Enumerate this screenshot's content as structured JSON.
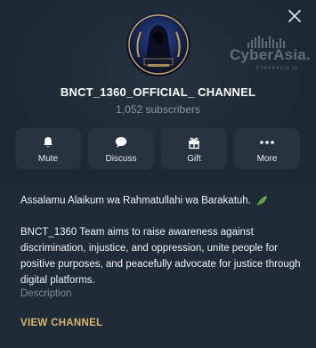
{
  "channel": {
    "title": "BNCT_1360_OFFICIAL_ CHANNEL",
    "subscribers": "1,052 subscribers",
    "avatar_icon": "hooded-figure-emblem-icon"
  },
  "actions": [
    {
      "label": "Mute",
      "icon": "bell-icon"
    },
    {
      "label": "Discuss",
      "icon": "chat-bubble-icon"
    },
    {
      "label": "Gift",
      "icon": "gift-icon"
    },
    {
      "label": "More",
      "icon": "more-dots-icon"
    }
  ],
  "about": {
    "greeting": "Assalamu Alaikum wa Rahmatullahi wa Barakatuh.",
    "description": "BNCT_1360 Team aims to raise awareness against discrimination, injustice, and oppression, unite people for positive purposes, and peacefully advocate for justice through digital platforms.",
    "description_label": "Description"
  },
  "view_channel_label": "VIEW CHANNEL",
  "watermark": {
    "text": "CyberAsia.",
    "subtext": "CYBERASIA.ID"
  },
  "colors": {
    "background": "#1c2a36",
    "button_bg": "#263440",
    "accent_gold": "#d8b46a",
    "muted_text": "#8b98a5"
  }
}
